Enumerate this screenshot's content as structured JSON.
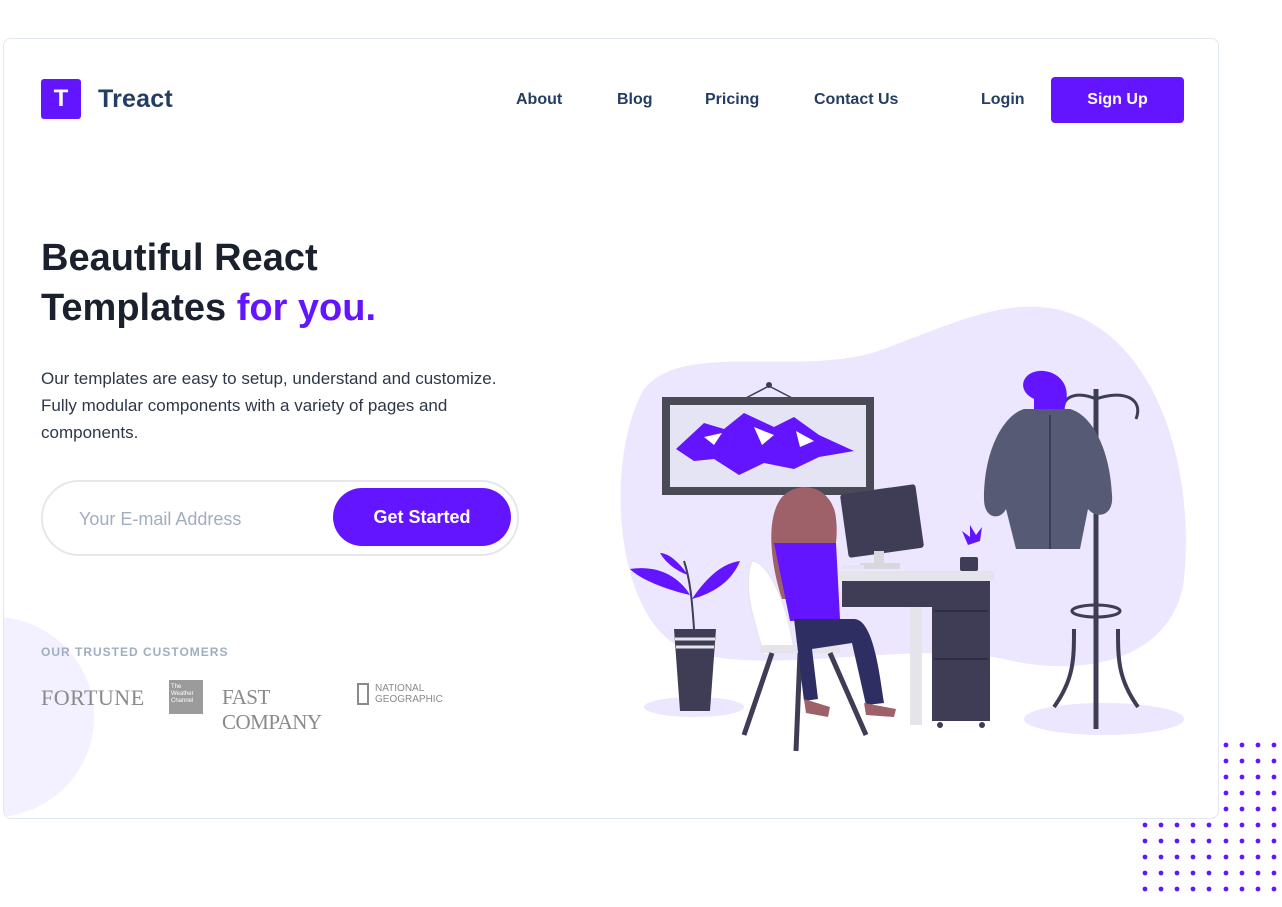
{
  "brand": {
    "mark": "T",
    "name": "Treact",
    "accent_color": "#6415ff"
  },
  "nav": {
    "links": [
      "About",
      "Blog",
      "Pricing",
      "Contact Us"
    ],
    "login": "Login",
    "signup": "Sign Up"
  },
  "hero": {
    "headline_line1": "Beautiful React",
    "headline_line2": "Templates",
    "headline_accent": "for you.",
    "description": "Our templates are easy to setup, understand and customize. Fully modular components with a variety of pages and components.",
    "email_placeholder": "Your E-mail Address",
    "cta": "Get Started"
  },
  "customers": {
    "label": "OUR TRUSTED CUSTOMERS",
    "logos": {
      "fortune": "FORTUNE",
      "weather_channel": "The Weather Channel",
      "fast_company": "FAST COMPANY",
      "national_geographic": "NATIONAL GEOGRAPHIC"
    }
  },
  "illustration": {
    "icon": "woman-at-desk-illustration"
  }
}
